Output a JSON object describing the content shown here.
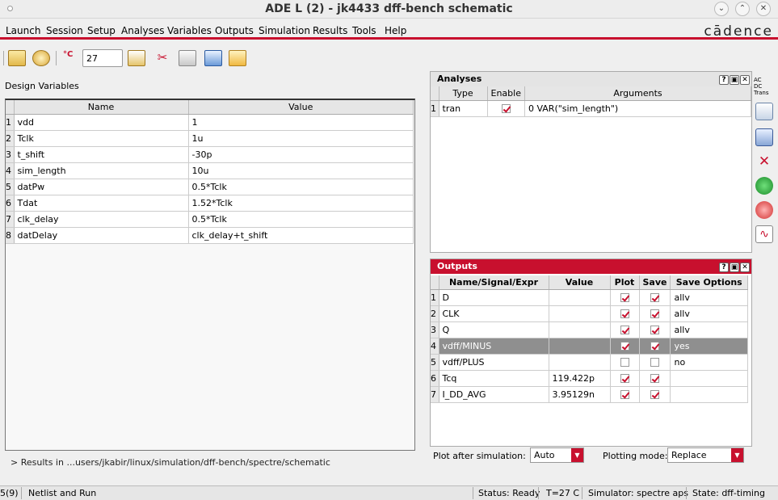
{
  "window": {
    "title": "ADE L (2) - jk4433 dff-bench schematic"
  },
  "menu": [
    {
      "label": "Launch"
    },
    {
      "label": "Session"
    },
    {
      "label": "Setup"
    },
    {
      "label": "Analyses"
    },
    {
      "label": "Variables"
    },
    {
      "label": "Outputs"
    },
    {
      "label": "Simulation"
    },
    {
      "label": "Results"
    },
    {
      "label": "Tools"
    },
    {
      "label": "Help"
    }
  ],
  "brand": {
    "logo": "cādence",
    "accent": "#c8102e"
  },
  "toolbar": {
    "temperature": "27",
    "temp_unit": "°C"
  },
  "design_variables": {
    "label": "Design Variables",
    "columns": [
      "Name",
      "Value"
    ],
    "rows": [
      {
        "n": "1",
        "name": "vdd",
        "value": "1"
      },
      {
        "n": "2",
        "name": "Tclk",
        "value": "1u"
      },
      {
        "n": "3",
        "name": "t_shift",
        "value": "-30p"
      },
      {
        "n": "4",
        "name": "sim_length",
        "value": "10u"
      },
      {
        "n": "5",
        "name": "datPw",
        "value": "0.5*Tclk"
      },
      {
        "n": "6",
        "name": "Tdat",
        "value": "1.52*Tclk"
      },
      {
        "n": "7",
        "name": "clk_delay",
        "value": "0.5*Tclk"
      },
      {
        "n": "8",
        "name": "datDelay",
        "value": "clk_delay+t_shift"
      }
    ]
  },
  "results_line": "> Results in ...users/jkabir/linux/simulation/dff-bench/spectre/schematic",
  "analyses": {
    "title": "Analyses",
    "columns": [
      "Type",
      "Enable",
      "Arguments"
    ],
    "rows": [
      {
        "n": "1",
        "type": "tran",
        "enabled": true,
        "args": "0 VAR(\"sim_length\")"
      }
    ]
  },
  "outputs": {
    "title": "Outputs",
    "columns": [
      "Name/Signal/Expr",
      "Value",
      "Plot",
      "Save",
      "Save Options"
    ],
    "rows": [
      {
        "n": "1",
        "name": "D",
        "value": "",
        "plot": true,
        "save": true,
        "opt": "allv"
      },
      {
        "n": "2",
        "name": "CLK",
        "value": "",
        "plot": true,
        "save": true,
        "opt": "allv"
      },
      {
        "n": "3",
        "name": "Q",
        "value": "",
        "plot": true,
        "save": true,
        "opt": "allv"
      },
      {
        "n": "4",
        "name": "vdff/MINUS",
        "value": "",
        "plot": true,
        "save": true,
        "opt": "yes",
        "selected": true
      },
      {
        "n": "5",
        "name": "vdff/PLUS",
        "value": "",
        "plot": false,
        "save": false,
        "opt": "no"
      },
      {
        "n": "6",
        "name": "Tcq",
        "value": "119.422p",
        "plot": true,
        "save": true,
        "opt": ""
      },
      {
        "n": "7",
        "name": "I_DD_AVG",
        "value": "3.95129n",
        "plot": true,
        "save": true,
        "opt": ""
      }
    ]
  },
  "plot_after": {
    "label": "Plot after simulation:",
    "value": "Auto"
  },
  "plotting_mode": {
    "label": "Plotting mode:",
    "value": "Replace"
  },
  "vtool": {
    "an_ac": "AC",
    "an_dc": "DC",
    "an_trans": "Trans"
  },
  "status": {
    "counter": "5(9)",
    "message": "Netlist and Run",
    "state": "Status: Ready",
    "temp": "T=27 C",
    "simulator": "Simulator: spectre aps",
    "setup": "State: dff-timing"
  }
}
